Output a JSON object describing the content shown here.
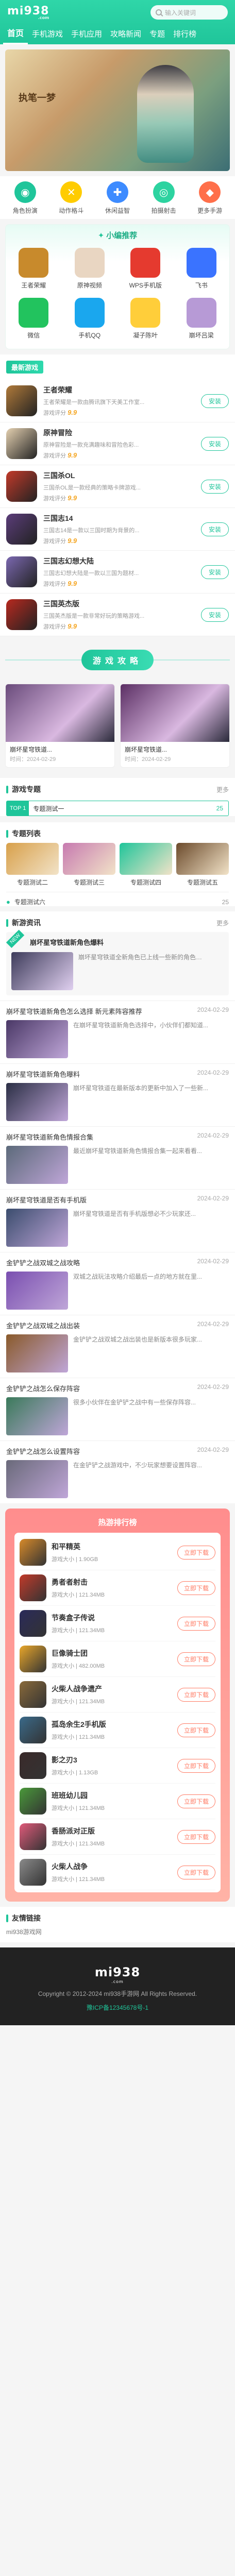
{
  "header": {
    "logo": "mi938",
    "logo_sub": ".com",
    "search_placeholder": "输入关键词",
    "nav": [
      "首页",
      "手机游戏",
      "手机应用",
      "攻略新闻",
      "专题",
      "排行榜"
    ]
  },
  "banner": {
    "text": "执笔一梦"
  },
  "categories": [
    {
      "label": "角色扮演",
      "icon": "controller-icon",
      "color": "#1fc59a"
    },
    {
      "label": "动作格斗",
      "icon": "cross-swords-icon",
      "color": "#ffcc00"
    },
    {
      "label": "休闲益智",
      "icon": "puzzle-icon",
      "color": "#3d8bff"
    },
    {
      "label": "拍摄射击",
      "icon": "target-icon",
      "color": "#2dd3a0"
    },
    {
      "label": "更多手游",
      "icon": "gamepad-icon",
      "color": "#ff6f4a"
    }
  ],
  "recommend": {
    "title": "小编推荐",
    "apps": [
      {
        "name": "王者荣耀",
        "color": "#c88a2c"
      },
      {
        "name": "原神视频",
        "color": "#e9d6c2"
      },
      {
        "name": "WPS手机版",
        "color": "#e53a2f"
      },
      {
        "name": "飞书",
        "color": "#3a73ff"
      },
      {
        "name": "微信",
        "color": "#22c35e"
      },
      {
        "name": "手机QQ",
        "color": "#1aa7ee"
      },
      {
        "name": "凝子陈叶",
        "color": "#ffce3a"
      },
      {
        "name": "崩坏吕梁",
        "color": "#b79ad6"
      }
    ]
  },
  "latest_games": {
    "title": "最新游戏",
    "items": [
      {
        "name": "王者荣耀",
        "desc": "王者荣耀是一款由腾讯旗下天美工作室...",
        "score_label": "游戏评分",
        "score": "9.9",
        "color": "#b07a3a"
      },
      {
        "name": "原神冒险",
        "desc": "原神冒险是一款充满趣味和冒险色彩...",
        "score_label": "游戏评分",
        "score": "9.9",
        "color": "#e4d0b0"
      },
      {
        "name": "三国杀OL",
        "desc": "三国杀OL是一款经典的策略卡牌游戏...",
        "score_label": "游戏评分",
        "score": "9.9",
        "color": "#c23a2a"
      },
      {
        "name": "三国志14",
        "desc": "三国志14是一款以三国时期为背景的...",
        "score_label": "游戏评分",
        "score": "9.9",
        "color": "#5b3d7a"
      },
      {
        "name": "三国志幻想大陆",
        "desc": "三国志幻想大陆是一款以三国为题材...",
        "score_label": "游戏评分",
        "score": "9.9",
        "color": "#7b68b0"
      },
      {
        "name": "三国英杰版",
        "desc": "三国英杰版是一款非常好玩的策略游戏...",
        "score_label": "游戏评分",
        "score": "9.9",
        "color": "#b8291f"
      }
    ],
    "button": "安装"
  },
  "topic_banner": {
    "text": "游戏攻略"
  },
  "topics": [
    {
      "title": "崩坏星穹铁道...",
      "date": "时间：2024-02-29",
      "color": "#6a4b7b"
    },
    {
      "title": "崩坏星穹铁道...",
      "date": "时间：2024-02-29",
      "color": "#5b2f64"
    }
  ],
  "collection": {
    "title": "游戏专题",
    "more": "更多",
    "top_label": "TOP 1",
    "top_name": "专题测试一",
    "top_count": "25"
  },
  "topic_list": {
    "title": "专题列表",
    "items": [
      {
        "name": "专题测试二",
        "color": "#d8a04a"
      },
      {
        "name": "专题测试三",
        "color": "#c77ab0"
      },
      {
        "name": "专题测试四",
        "color": "#1fc59a"
      },
      {
        "name": "专题测试五",
        "color": "#6b4a2b"
      }
    ],
    "row_name": "专题测试六",
    "row_count": "25"
  },
  "news": {
    "title": "新游资讯",
    "more": "更多",
    "first": {
      "badge": "NEW",
      "title": "崩坏星穹铁道新角色爆料",
      "desc": "崩坏星穹铁道全新角色已上线一些新的角色…",
      "color": "#3d3b5a"
    },
    "items": [
      {
        "title": "崩坏星穹铁道新角色怎么选择 新元素阵容推荐",
        "date": "2024-02-29",
        "desc": "在崩坏星穹铁道新角色选择中，小伙伴们都知道...",
        "color": "#4a3866"
      },
      {
        "title": "崩坏星穹铁道新角色曝料",
        "date": "2024-02-29",
        "desc": "崩坏星穹铁道在最新版本的更新中加入了一些新...",
        "color": "#2b2f45"
      },
      {
        "title": "崩坏星穹铁道新角色情报合集",
        "date": "2024-02-29",
        "desc": "最近崩坏星穹铁道新角色情报合集一起来看看...",
        "color": "#5c6a7a"
      },
      {
        "title": "崩坏星穹铁道是否有手机版",
        "date": "2024-02-29",
        "desc": "崩坏星穹铁道是否有手机版想必不少玩家还...",
        "color": "#3b4d6e"
      },
      {
        "title": "金铲铲之战双城之战攻略",
        "date": "2024-02-29",
        "desc": "双城之战玩法攻略介绍最后一点的地方就在里...",
        "color": "#7a4fb0"
      },
      {
        "title": "金铲铲之战双城之战出装",
        "date": "2024-02-29",
        "desc": "金铲铲之战双城之战出装也是新版本很多玩家...",
        "color": "#8a5a2a"
      },
      {
        "title": "金铲铲之战怎么保存阵容",
        "date": "2024-02-29",
        "desc": "很多小伙伴在金铲铲之战中有一些保存阵容...",
        "color": "#3a7a5a"
      },
      {
        "title": "金铲铲之战怎么设置阵容",
        "date": "2024-02-29",
        "desc": "在金铲铲之战游戏中，不少玩家想要设置阵容...",
        "color": "#6a6a7a"
      }
    ]
  },
  "ranking": {
    "title": "热游排行榜",
    "button": "立即下载",
    "items": [
      {
        "name": "和平精英",
        "size": "游戏大小 | 1.90GB",
        "color": "#d78a2a"
      },
      {
        "name": "勇者者射击",
        "size": "游戏大小 | 121.34MB",
        "color": "#c23a2a"
      },
      {
        "name": "节奏盒子传说",
        "size": "游戏大小 | 121.34MB",
        "color": "#2a2a5a"
      },
      {
        "name": "巨像骑士团",
        "size": "游戏大小 | 482.00MB",
        "color": "#e8a62a"
      },
      {
        "name": "火柴人战争遗产",
        "size": "游戏大小 | 121.34MB",
        "color": "#8a6a3a"
      },
      {
        "name": "孤岛余生2手机版",
        "size": "游戏大小 | 121.34MB",
        "color": "#3a6a8a"
      },
      {
        "name": "影之刃3",
        "size": "游戏大小 | 1.13GB",
        "color": "#3a2a2a"
      },
      {
        "name": "班班幼儿园",
        "size": "游戏大小 | 121.34MB",
        "color": "#4a9a3a"
      },
      {
        "name": "香肠派对正版",
        "size": "游戏大小 | 121.34MB",
        "color": "#e05a7a"
      },
      {
        "name": "火柴人战争",
        "size": "游戏大小 | 121.34MB",
        "color": "#8a8a8a"
      }
    ]
  },
  "links": {
    "title": "友情链接",
    "item": "mi938游戏网"
  },
  "footer": {
    "logo": "mi938",
    "logo_sub": ".com",
    "copyright": "Copyright © 2012-2024 mi938手游网 All Rights Reserved.",
    "icp": "豫ICP备12345678号-1"
  }
}
